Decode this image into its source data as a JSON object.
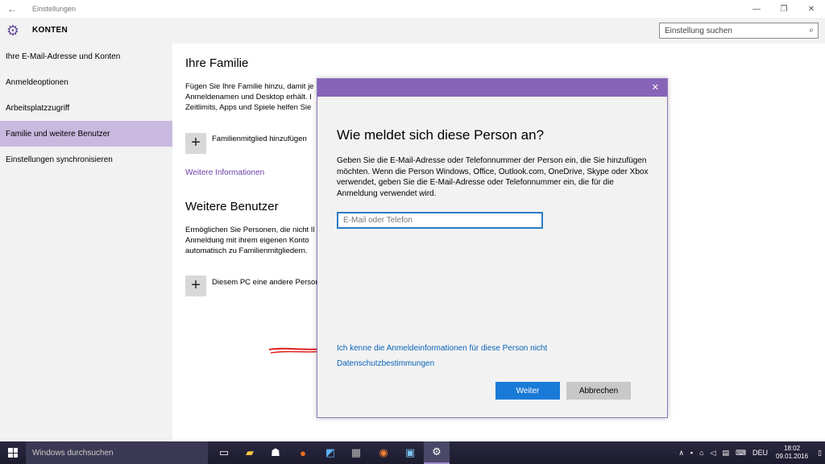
{
  "window": {
    "title": "Einstellungen",
    "controls": [
      "—",
      "❐",
      "✕"
    ]
  },
  "header": {
    "title": "KONTEN",
    "search_placeholder": "Einstellung suchen"
  },
  "sidebar": {
    "items": [
      {
        "label": "Ihre E-Mail-Adresse und Konten"
      },
      {
        "label": "Anmeldeoptionen"
      },
      {
        "label": "Arbeitsplatzzugriff"
      },
      {
        "label": "Familie und weitere Benutzer",
        "active": true
      },
      {
        "label": "Einstellungen synchronisieren"
      }
    ]
  },
  "main": {
    "family_heading": "Ihre Familie",
    "family_text": [
      "Fügen Sie Ihre Familie hinzu, damit je",
      "Anmeldenamen und Desktop erhält. I",
      "Zeitlimits, Apps und Spiele helfen Sie"
    ],
    "add_family_label": "Familienmitglied hinzufügen",
    "more_info_link": "Weitere Informationen",
    "others_heading": "Weitere Benutzer",
    "others_text": [
      "Ermöglichen Sie Personen, die nicht Il",
      "Anmeldung mit ihrem eigenen Konto",
      "automatisch zu Familienmitgliedern."
    ],
    "add_other_label": "Diesem PC eine andere Person"
  },
  "dialog": {
    "heading": "Wie meldet sich diese Person an?",
    "description": "Geben Sie die E-Mail-Adresse oder Telefonnummer der Person ein, die Sie hinzufügen möchten. Wenn die Person Windows, Office, Outlook.com, OneDrive, Skype oder Xbox verwendet, geben Sie die E-Mail-Adresse oder Telefonnummer ein, die für die Anmeldung verwendet wird.",
    "email_placeholder": "E-Mail oder Telefon",
    "no_info_link": "Ich kenne die Anmeldeinformationen für diese Person nicht",
    "privacy_link": "Datenschutzbestimmungen",
    "next_button": "Weiter",
    "cancel_button": "Abbrechen"
  },
  "taskbar": {
    "search_placeholder": "Windows durchsuchen",
    "language": "DEU",
    "time": "18:02",
    "date": "09.01.2016"
  },
  "colors": {
    "accent": "#8764b8",
    "sidebar_active": "#c9b9df",
    "primary_button": "#1a7ad8",
    "link": "#0a63b8"
  }
}
